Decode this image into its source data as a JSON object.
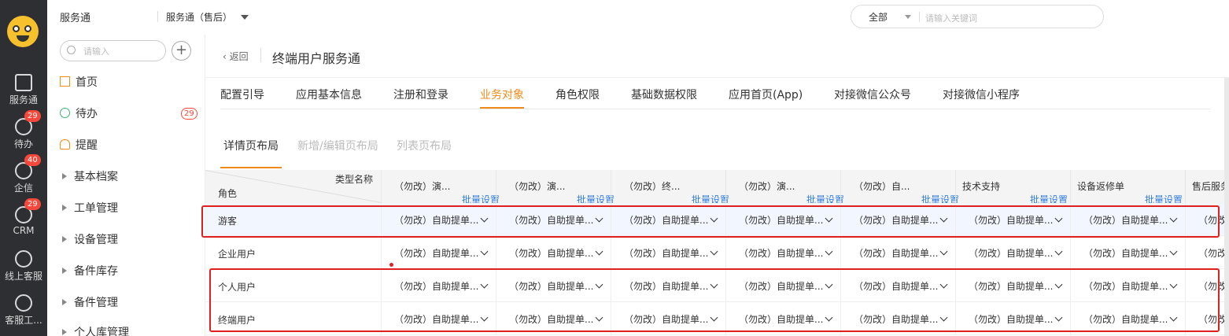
{
  "rail": {
    "items": [
      {
        "label": "服务通",
        "badge": ""
      },
      {
        "label": "待办",
        "badge": "29"
      },
      {
        "label": "企信",
        "badge": "40"
      },
      {
        "label": "CRM",
        "badge": "29"
      },
      {
        "label": "线上客服",
        "badge": ""
      },
      {
        "label": "客服工...",
        "badge": ""
      }
    ]
  },
  "topbar": {
    "app_name": "服务通",
    "current_app": "服务通（售后）",
    "search_scope": "全部",
    "search_placeholder": "请输入关键词"
  },
  "menu": {
    "search_placeholder": "请输入",
    "add_label": "+",
    "items": [
      {
        "label": "首页",
        "count": ""
      },
      {
        "label": "待办",
        "count": "29"
      },
      {
        "label": "提醒",
        "count": ""
      },
      {
        "label": "基本档案",
        "count": ""
      },
      {
        "label": "工单管理",
        "count": ""
      },
      {
        "label": "设备管理",
        "count": ""
      },
      {
        "label": "备件库存",
        "count": ""
      },
      {
        "label": "备件管理",
        "count": ""
      },
      {
        "label": "个人库管理",
        "count": ""
      }
    ]
  },
  "main": {
    "back_label": "返回",
    "page_title": "终端用户服务通",
    "tabs": [
      {
        "label": "配置引导",
        "active": false
      },
      {
        "label": "应用基本信息",
        "active": false
      },
      {
        "label": "注册和登录",
        "active": false
      },
      {
        "label": "业务对象",
        "active": true
      },
      {
        "label": "角色权限",
        "active": false
      },
      {
        "label": "基础数据权限",
        "active": false
      },
      {
        "label": "应用首页(App)",
        "active": false
      },
      {
        "label": "对接微信公众号",
        "active": false
      },
      {
        "label": "对接微信小程序",
        "active": false
      }
    ],
    "sub_tabs": [
      {
        "label": "详情页布局",
        "active": true
      },
      {
        "label": "新增/编辑页布局",
        "active": false
      },
      {
        "label": "列表页布局",
        "active": false
      }
    ]
  },
  "table": {
    "corner_type_label": "类型名称",
    "corner_role_label": "角色",
    "batch_label": "批量设置",
    "columns": [
      "（勿改）演...",
      "（勿改）演...",
      "（勿改）终...",
      "（勿改）演...",
      "（勿改）自...",
      "技术支持",
      "设备返修单",
      "售后服务"
    ],
    "cell_value": "（勿改）自助提单...",
    "cell_value_truncated": "（勿改）",
    "rows": [
      {
        "role": "游客",
        "highlighted": true
      },
      {
        "role": "企业用户",
        "highlighted": false
      },
      {
        "role": "个人用户",
        "highlighted": false
      },
      {
        "role": "终端用户",
        "highlighted": false
      }
    ]
  },
  "colors": {
    "accent": "#ef8b1b",
    "link": "#2f7de1",
    "annotation": "#e02020",
    "rail_bg": "#2d2f33"
  }
}
